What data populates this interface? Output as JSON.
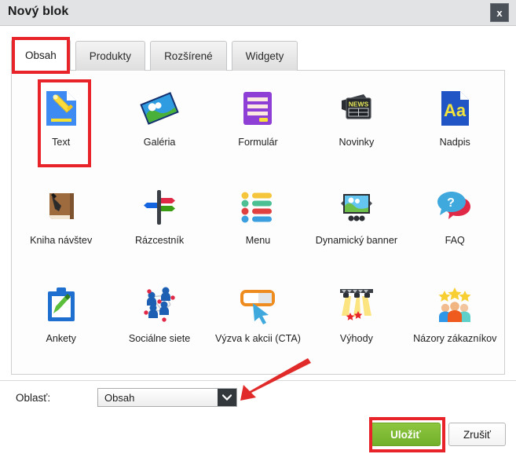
{
  "window": {
    "title": "Nový blok",
    "close_label": "x",
    "close_icon": "close-icon"
  },
  "tabs": [
    {
      "label": "Obsah",
      "active": true
    },
    {
      "label": "Produkty",
      "active": false
    },
    {
      "label": "Rozšírené",
      "active": false
    },
    {
      "label": "Widgety",
      "active": false
    }
  ],
  "blocks": [
    {
      "label": "Text",
      "icon": "text-document-pencil-icon",
      "selected": true
    },
    {
      "label": "Galéria",
      "icon": "gallery-photo-icon",
      "selected": false
    },
    {
      "label": "Formulár",
      "icon": "form-icon",
      "selected": false
    },
    {
      "label": "Novinky",
      "icon": "news-icon",
      "selected": false
    },
    {
      "label": "Nadpis",
      "icon": "heading-aa-icon",
      "selected": false
    },
    {
      "label": "Kniha návštev",
      "icon": "guestbook-icon",
      "selected": false
    },
    {
      "label": "Rázcestník",
      "icon": "signpost-icon",
      "selected": false
    },
    {
      "label": "Menu",
      "icon": "menu-list-icon",
      "selected": false
    },
    {
      "label": "Dynamický banner",
      "icon": "dynamic-banner-icon",
      "selected": false
    },
    {
      "label": "FAQ",
      "icon": "faq-speech-bubble-icon",
      "selected": false
    },
    {
      "label": "Ankety",
      "icon": "poll-clipboard-icon",
      "selected": false
    },
    {
      "label": "Sociálne siete",
      "icon": "social-network-icon",
      "selected": false
    },
    {
      "label": "Výzva k akcii (CTA)",
      "icon": "cta-cursor-button-icon",
      "selected": false
    },
    {
      "label": "Výhody",
      "icon": "benefits-spotlight-icon",
      "selected": false
    },
    {
      "label": "Názory zákazníkov",
      "icon": "customer-reviews-stars-icon",
      "selected": false
    }
  ],
  "area_field": {
    "label": "Oblasť:",
    "value": "Obsah",
    "dropdown_icon": "chevron-down-icon"
  },
  "buttons": {
    "save": "Uložiť",
    "cancel": "Zrušiť"
  },
  "annotations": {
    "highlight_color": "#e8232a",
    "arrow_color": "#e12b2b",
    "highlighted_items": [
      "Obsah",
      "Text",
      "Uložiť"
    ],
    "arrow_points_to": "dropdown-arrow"
  },
  "colors": {
    "titlebar_bg": "#e1e3e5",
    "panel_bg": "#fdfdfd",
    "save_green": "#7cb82f",
    "close_dark": "#4b5159"
  }
}
